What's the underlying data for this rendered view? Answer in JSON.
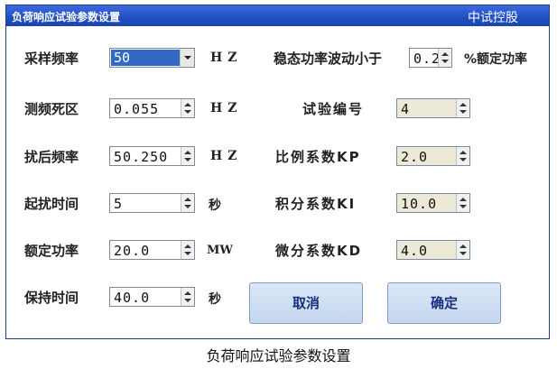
{
  "window": {
    "title": "负荷响应试验参数设置",
    "right_title": "中试控股"
  },
  "left": {
    "sample_freq": {
      "label": "采样频率",
      "value": "50",
      "unit": "HZ"
    },
    "dead_zone": {
      "label": "测频死区",
      "value": "0.055",
      "unit": "HZ"
    },
    "post_freq": {
      "label": "扰后频率",
      "value": "50.250",
      "unit": "HZ"
    },
    "start_time": {
      "label": "起扰时间",
      "value": "5",
      "unit": "秒"
    },
    "rated_power": {
      "label": "额定功率",
      "value": "20.0",
      "unit": "MW"
    },
    "hold_time": {
      "label": "保持时间",
      "value": "40.0",
      "unit": "秒"
    }
  },
  "right": {
    "steady": {
      "label": "稳态功率波动小于",
      "value": "0.2",
      "unit": "%额定功率"
    },
    "test_no": {
      "label": "试验编号",
      "value": "4"
    },
    "kp": {
      "label": "比例系数KP",
      "value": "2.0"
    },
    "ki": {
      "label": "积分系数KI",
      "value": "10.0"
    },
    "kd": {
      "label": "微分系数KD",
      "value": "4.0"
    }
  },
  "buttons": {
    "cancel": "取消",
    "ok": "确定"
  },
  "caption": "负荷响应试验参数设置"
}
